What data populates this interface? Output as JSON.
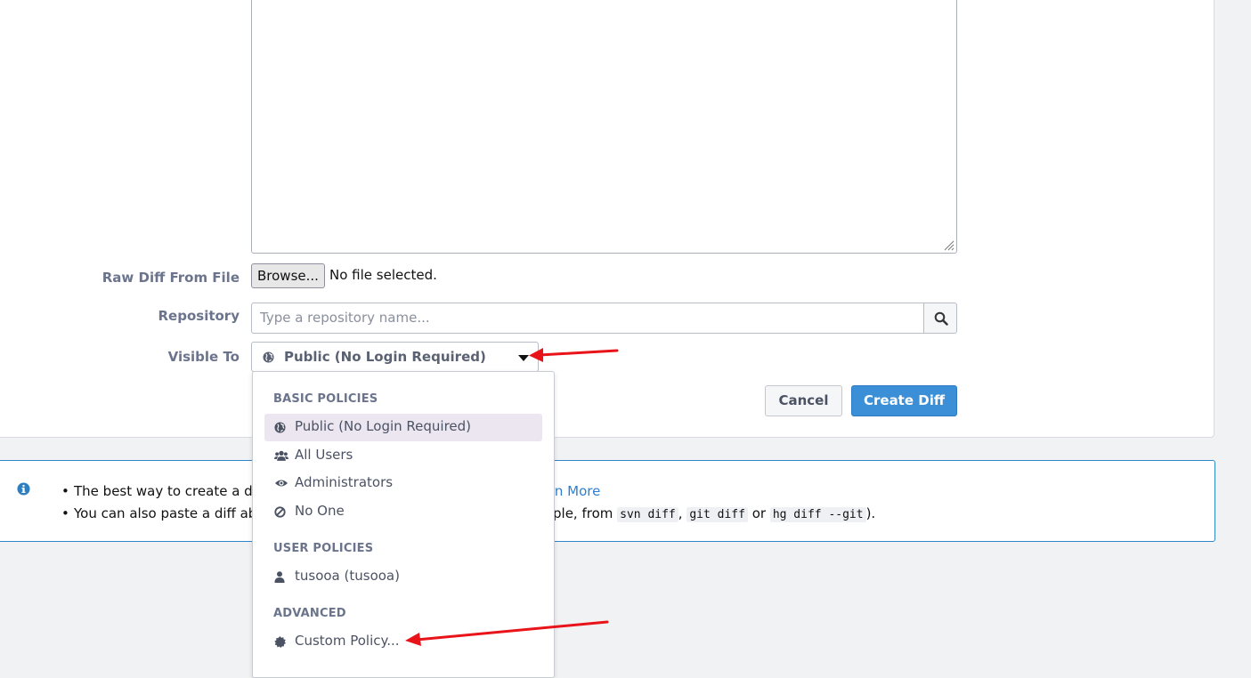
{
  "form": {
    "raw_diff_file_label": "Raw Diff From File",
    "browse_label": "Browse...",
    "file_status": "No file selected.",
    "repository_label": "Repository",
    "repository_placeholder": "Type a repository name...",
    "visible_to_label": "Visible To",
    "visible_to_value": "Public (No Login Required)",
    "cancel_label": "Cancel",
    "create_label": "Create Diff"
  },
  "info": {
    "line1_prefix": "The best way to create a dif",
    "learn_more": "rn More",
    "line2_prefix": "You can also paste a diff ab",
    "line2_mid": "ple, from ",
    "code1": "svn diff",
    "sep1": ", ",
    "code2": "git diff",
    "sep2": " or ",
    "code3": "hg diff --git",
    "line2_end": ")."
  },
  "dropdown": {
    "basic_header": "BASIC POLICIES",
    "basic_items": [
      {
        "label": "Public (No Login Required)",
        "icon": "globe-icon",
        "selected": true
      },
      {
        "label": "All Users",
        "icon": "users-icon"
      },
      {
        "label": "Administrators",
        "icon": "eye-icon"
      },
      {
        "label": "No One",
        "icon": "ban-icon"
      }
    ],
    "user_header": "USER POLICIES",
    "user_items": [
      {
        "label": "tusooa (tusooa)",
        "icon": "user-icon"
      }
    ],
    "advanced_header": "ADVANCED",
    "advanced_items": [
      {
        "label": "Custom Policy...",
        "icon": "certificate-icon"
      }
    ]
  },
  "colors": {
    "primary_button": "#3a8fd6",
    "annotation_arrow": "#e8141a",
    "selected_item_bg": "#ece6f1",
    "info_border": "#2f86c8"
  }
}
